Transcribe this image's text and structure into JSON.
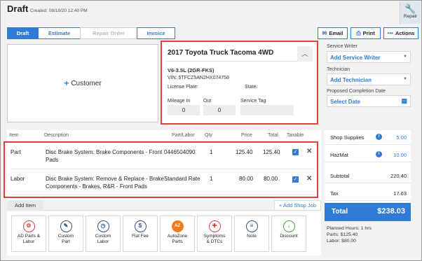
{
  "header": {
    "title": "Draft",
    "created": "Created: 08/18/20 12:40 PM",
    "repair_label": "Repair"
  },
  "tabs": [
    {
      "label": "Draft",
      "state": "active"
    },
    {
      "label": "Estimate",
      "state": "normal"
    },
    {
      "label": "Repair Order",
      "state": "disabled"
    },
    {
      "label": "Invoice",
      "state": "normal"
    }
  ],
  "toolbar": {
    "email": "Email",
    "print": "Print",
    "actions": "Actions"
  },
  "customer": {
    "label": "Customer"
  },
  "vehicle": {
    "title": "2017 Toyota Truck Tacoma 4WD",
    "engine": "V6-3.5L (2GR-FKS)",
    "vin": "VIN: 5TFCZ5AN2HX074758",
    "license_label": "License Plate:",
    "state_label": "State:",
    "mileage_in_label": "Mileage In",
    "mileage_out_label": "Out",
    "service_tag_label": "Service Tag",
    "mileage_in": "0",
    "mileage_out": "0",
    "service_tag": ""
  },
  "side": {
    "writer_label": "Service Writer",
    "writer_value": "Add Service Writer",
    "tech_label": "Technician",
    "tech_value": "Add Technician",
    "date_label": "Proposed Completion Date",
    "date_value": "Select Date"
  },
  "grid": {
    "headers": [
      "Item",
      "Description",
      "Part/Labor",
      "Qty",
      "Price",
      "Total",
      "Taxable"
    ],
    "rows": [
      {
        "item": "Part",
        "desc1": "Disc Brake System: Brake Components - Front",
        "desc2": "Pads",
        "partlabor": "0446504090",
        "qty": "1",
        "price": "125.40",
        "total": "125.40",
        "taxable": true
      },
      {
        "item": "Labor",
        "desc1": "Disc Brake System: Remove & Replace - Brake",
        "desc2": "Components - Brakes, R&R - Front Pads",
        "partlabor": "Standard Rate",
        "qty": "1",
        "price": "80.00",
        "total": "80.00",
        "taxable": true
      }
    ]
  },
  "add_item": {
    "label": "Add Item",
    "shop_job": "+ Add Shop Job"
  },
  "tiles": [
    {
      "label1": "AD Parts &",
      "label2": "Labor",
      "color": "#e04040",
      "glyph": "⚙"
    },
    {
      "label1": "Custom",
      "label2": "Part",
      "color": "#2f4f7f",
      "glyph": "✎"
    },
    {
      "label1": "Custom",
      "label2": "Labor",
      "color": "#2f4f7f",
      "glyph": "◷"
    },
    {
      "label1": "Flat Fee",
      "label2": "",
      "color": "#2f4f7f",
      "glyph": "$"
    },
    {
      "label1": "AutoZone",
      "label2": "Parts",
      "color": "#f07d1a",
      "glyph": "AZ"
    },
    {
      "label1": "Symptoms",
      "label2": "& DTCs",
      "color": "#e04040",
      "glyph": "✚"
    },
    {
      "label1": "Note",
      "label2": "",
      "color": "#2f4f7f",
      "glyph": "≡"
    },
    {
      "label1": "Discount",
      "label2": "",
      "color": "#3aa33a",
      "glyph": "↓"
    }
  ],
  "totals": {
    "shop_supplies_label": "Shop Supplies",
    "shop_supplies": "5.00",
    "hazmat_label": "HazMat",
    "hazmat": "10.00",
    "subtotal_label": "Subtotal",
    "subtotal": "220.40",
    "tax_label": "Tax",
    "tax": "17.63",
    "total_label": "Total",
    "total": "$238.03"
  },
  "summary": {
    "hours": "Planned Hours: 1 hrs",
    "parts": "Parts: $125.40",
    "labor": "Labor: $80.00"
  },
  "colors": {
    "accent": "#2f7bd6",
    "highlight": "#e04040"
  }
}
